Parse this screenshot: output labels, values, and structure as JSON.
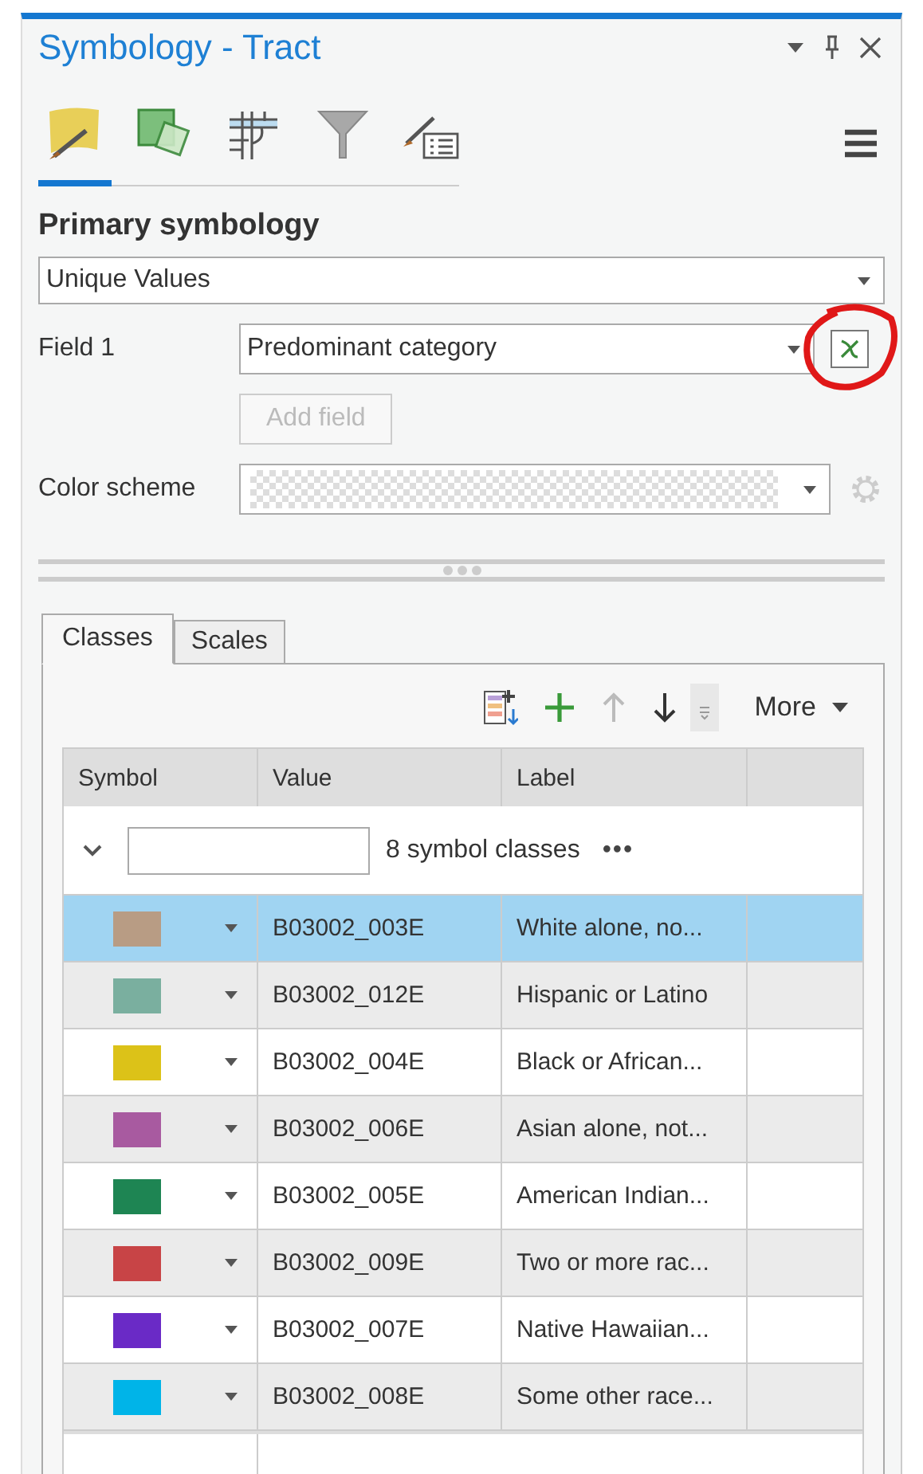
{
  "pane": {
    "title": "Symbology - Tract"
  },
  "pane_buttons": [
    {
      "kind": "options"
    },
    {
      "kind": "pin"
    },
    {
      "kind": "close"
    }
  ],
  "view_tabs": [
    {
      "kind": "primary",
      "selected": true
    },
    {
      "kind": "vary",
      "selected": false
    },
    {
      "kind": "advanced",
      "selected": false
    },
    {
      "kind": "filter",
      "selected": false
    },
    {
      "kind": "labels",
      "selected": false
    }
  ],
  "section_title": "Primary symbology",
  "symbology_type": {
    "value": "Unique Values"
  },
  "field_1": {
    "label": "Field 1",
    "value": "Predominant category",
    "expression_button_highlighted": true
  },
  "add_field": {
    "label": "Add field",
    "disabled": true
  },
  "color_scheme": {
    "label": "Color scheme",
    "settings_disabled": true
  },
  "tabs": [
    {
      "label": "Classes",
      "selected": true
    },
    {
      "label": "Scales",
      "selected": false
    }
  ],
  "toolbar": {
    "more": "More",
    "up_disabled": true,
    "down_disabled": false
  },
  "table": {
    "columns": [
      "Symbol",
      "Value",
      "Label"
    ],
    "group": {
      "expanded": true,
      "count": "8 symbol classes",
      "menu": "•••"
    },
    "rows": [
      {
        "color": "#b89c84",
        "value": "B03002_003E",
        "label": "White alone, no...",
        "selected": true
      },
      {
        "color": "#7aaf9f",
        "value": "B03002_012E",
        "label": "Hispanic or Latino",
        "selected": false
      },
      {
        "color": "#dcc218",
        "value": "B03002_004E",
        "label": "Black or African...",
        "selected": false
      },
      {
        "color": "#a85aa0",
        "value": "B03002_006E",
        "label": "Asian alone, not...",
        "selected": false
      },
      {
        "color": "#1e8553",
        "value": "B03002_005E",
        "label": "American Indian...",
        "selected": false
      },
      {
        "color": "#c84446",
        "value": "B03002_009E",
        "label": "Two or more rac...",
        "selected": false
      },
      {
        "color": "#6a2ac6",
        "value": "B03002_007E",
        "label": "Native Hawaiian...",
        "selected": false
      },
      {
        "color": "#00b4e8",
        "value": "B03002_008E",
        "label": "Some other race...",
        "selected": false
      }
    ]
  }
}
